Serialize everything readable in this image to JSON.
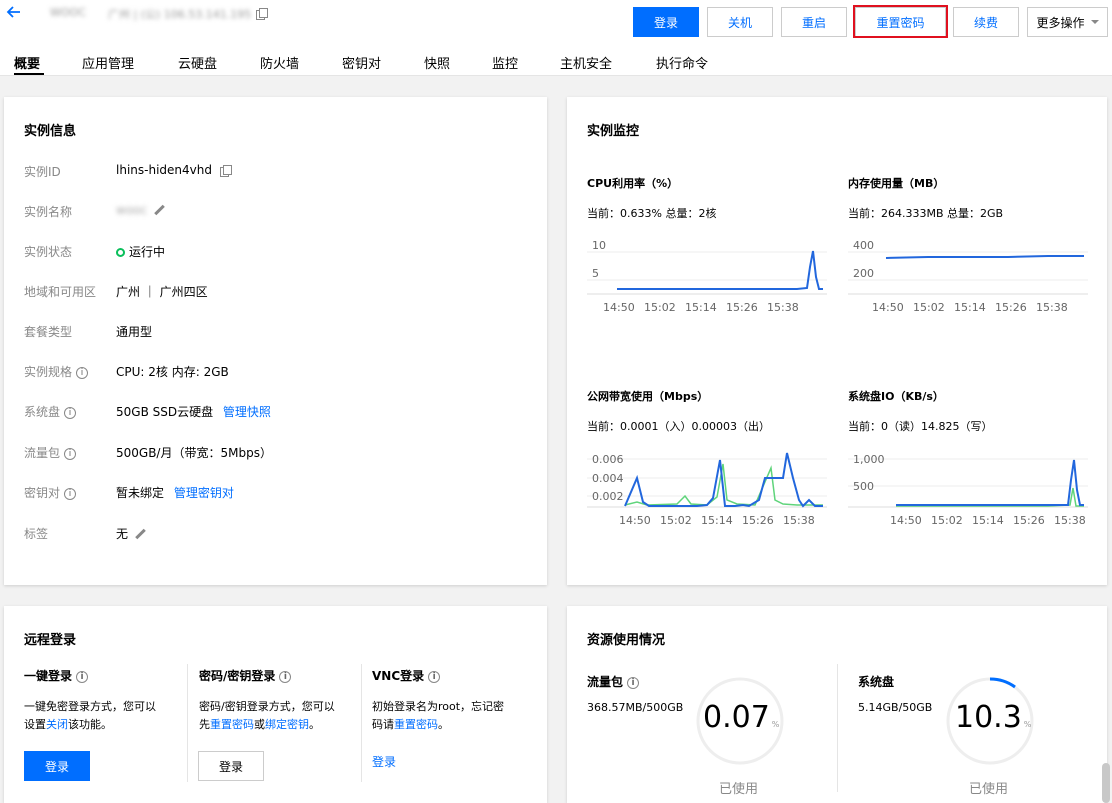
{
  "header": {
    "instance_name": "WOOC",
    "instance_region": "广州 | (公) 106.53.141.195",
    "buttons": {
      "login": "登录",
      "shutdown": "关机",
      "restart": "重启",
      "reset_password": "重置密码",
      "renew": "续费",
      "more": "更多操作"
    }
  },
  "tabs": [
    "概要",
    "应用管理",
    "云硬盘",
    "防火墙",
    "密钥对",
    "快照",
    "监控",
    "主机安全",
    "执行命令"
  ],
  "instance_info": {
    "title": "实例信息",
    "rows": [
      {
        "label": "实例ID",
        "value": "lhins-hiden4vhd"
      },
      {
        "label": "实例名称",
        "value": "wooc"
      },
      {
        "label": "实例状态",
        "value": "运行中"
      },
      {
        "label": "地域和可用区",
        "value": "广州 ｜ 广州四区"
      },
      {
        "label": "套餐类型",
        "value": "通用型"
      },
      {
        "label": "实例规格",
        "value": "CPU: 2核 内存: 2GB"
      },
      {
        "label": "系统盘",
        "value": "50GB SSD云硬盘",
        "link": "管理快照"
      },
      {
        "label": "流量包",
        "value": "500GB/月（带宽：5Mbps）"
      },
      {
        "label": "密钥对",
        "value": "暂未绑定",
        "link": "管理密钥对"
      },
      {
        "label": "标签",
        "value": "无"
      }
    ],
    "status_color": "#0abf5b"
  },
  "monitor": {
    "title": "实例监控",
    "charts": [
      {
        "title": "CPU利用率（%）",
        "current": "当前：0.633% 总量：2核",
        "yticks": [
          "10",
          "5"
        ],
        "xticks": [
          "14:50",
          "15:02",
          "15:14",
          "15:26",
          "15:38"
        ]
      },
      {
        "title": "内存使用量（MB）",
        "current": "当前：264.333MB 总量：2GB",
        "yticks": [
          "400",
          "200"
        ],
        "xticks": [
          "14:50",
          "15:02",
          "15:14",
          "15:26",
          "15:38"
        ]
      },
      {
        "title": "公网带宽使用（Mbps）",
        "current": "当前：0.0001（入）0.00003（出）",
        "yticks": [
          "0.006",
          "0.004",
          "0.002"
        ],
        "xticks": [
          "14:50",
          "15:02",
          "15:14",
          "15:26",
          "15:38"
        ]
      },
      {
        "title": "系统盘IO（KB/s）",
        "current": "当前：0（读）14.825（写）",
        "yticks": [
          "1,000",
          "500"
        ],
        "xticks": [
          "14:50",
          "15:02",
          "15:14",
          "15:26",
          "15:38"
        ]
      }
    ],
    "line_color": "#2267dd",
    "alt_line_color": "#5fd47b"
  },
  "remote_login": {
    "title": "远程登录",
    "one_click": {
      "title": "一键登录",
      "desc1": "一键免密登录方式，您可以",
      "desc2a": "设置",
      "desc2_link": "关闭",
      "desc2b": "该功能。",
      "button": "登录"
    },
    "password": {
      "title": "密码/密钥登录",
      "desc1": "密码/密钥登录方式，您可以",
      "desc2a": "先",
      "link1": "重置密码",
      "desc2b": "或",
      "link2": "绑定密钥",
      "desc2c": "。",
      "button": "登录"
    },
    "vnc": {
      "title": "VNC登录",
      "desc1": "初始登录名为root，忘记密",
      "desc2a": "码请",
      "link": "重置密码",
      "desc2b": "。",
      "button": "登录"
    }
  },
  "resource": {
    "title": "资源使用情况",
    "traffic": {
      "title": "流量包",
      "usage": "368.57MB/500GB",
      "percent": "0.07",
      "unit": "%",
      "caption": "已使用"
    },
    "disk": {
      "title": "系统盘",
      "usage": "5.14GB/50GB",
      "percent": "10.3",
      "unit": "%",
      "caption": "已使用"
    }
  }
}
